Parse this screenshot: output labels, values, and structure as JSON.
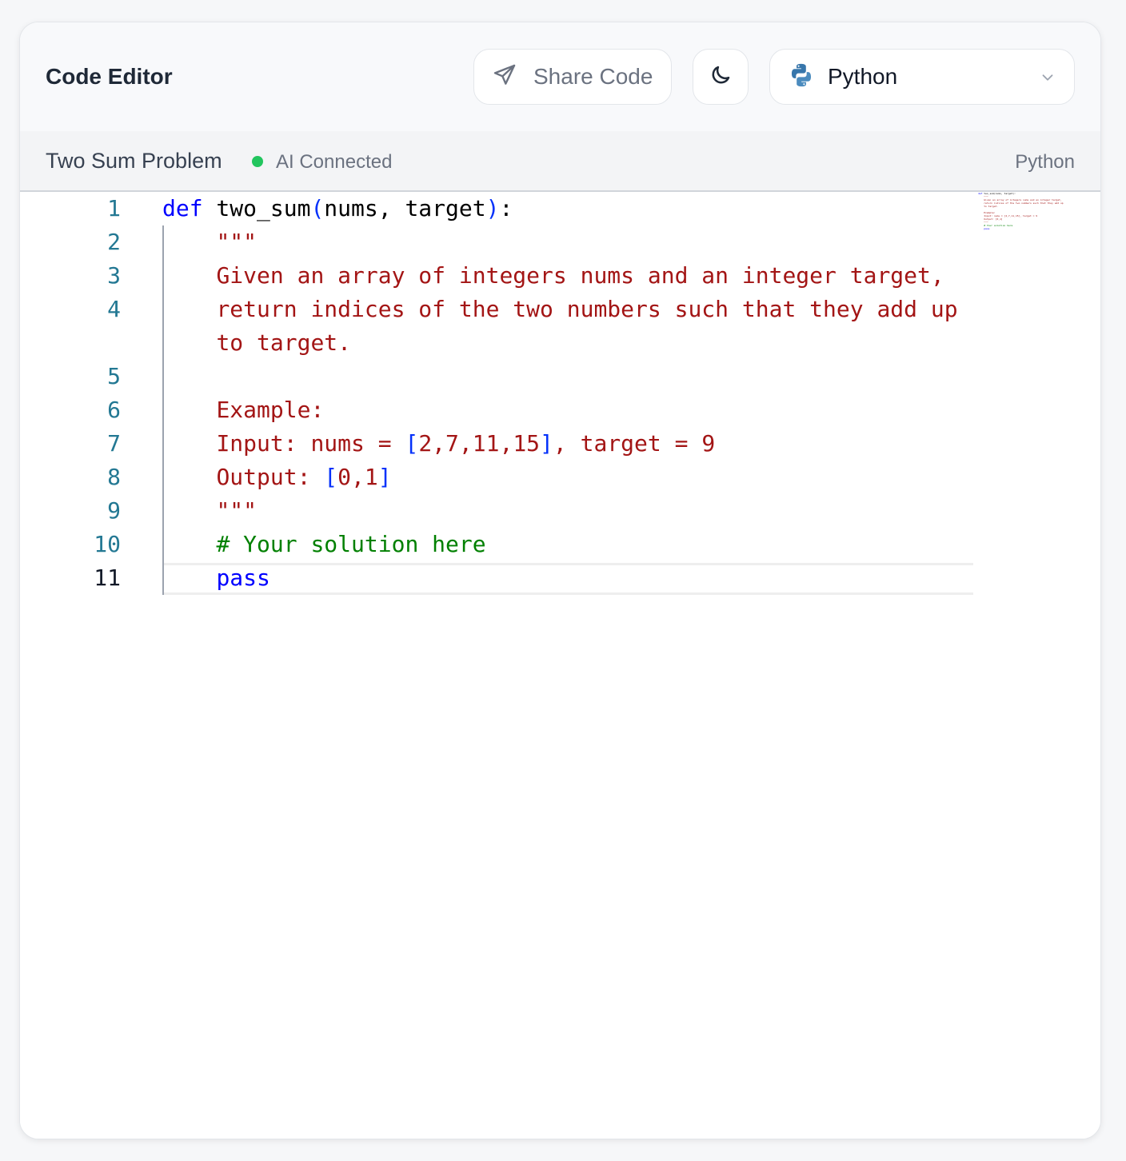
{
  "header": {
    "title": "Code Editor",
    "share_label": "Share Code",
    "language_selected": "Python"
  },
  "file": {
    "title": "Two Sum Problem",
    "status": "AI Connected",
    "language": "Python"
  },
  "editor": {
    "line_numbers": [
      "1",
      "2",
      "3",
      "4",
      "5",
      "6",
      "7",
      "8",
      "9",
      "10",
      "11"
    ],
    "active_line": 11
  },
  "colors": {
    "keyword": "#0000ff",
    "string": "#a31515",
    "comment": "#008000",
    "status_ok": "#22c55e"
  },
  "icons": [
    "send-icon",
    "moon-icon",
    "python-icon",
    "chevron-down-icon"
  ]
}
